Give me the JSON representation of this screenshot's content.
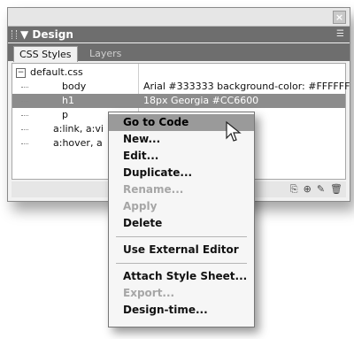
{
  "panel": {
    "close_icon": "close-icon",
    "title": "Design",
    "title_arrow": "▼",
    "options_icon": "panel-options-icon",
    "tabs": [
      {
        "label": "CSS Styles",
        "active": true
      },
      {
        "label": "Layers",
        "active": false
      }
    ]
  },
  "styles": {
    "file": {
      "expander": "−",
      "name": "default.css"
    },
    "rules": [
      {
        "name": "body",
        "value": "Arial #333333 background-color: #FFFFFF"
      },
      {
        "name": "h1",
        "value": "18px Georgia #CC6600",
        "selected": true
      },
      {
        "name": "p",
        "value": ""
      },
      {
        "name": "a:link, a:vi",
        "value": ""
      },
      {
        "name": "a:hover, a",
        "value": ""
      }
    ]
  },
  "toolbar": {
    "icons": [
      "attach-style-sheet-icon",
      "new-css-rule-icon",
      "edit-style-icon",
      "delete-icon"
    ]
  },
  "context_menu": {
    "items": [
      {
        "label": "Go to Code",
        "enabled": true,
        "highlighted": true
      },
      {
        "label": "New...",
        "enabled": true
      },
      {
        "label": "Edit...",
        "enabled": true
      },
      {
        "label": "Duplicate...",
        "enabled": true
      },
      {
        "label": "Rename...",
        "enabled": false
      },
      {
        "label": "Apply",
        "enabled": false
      },
      {
        "label": "Delete",
        "enabled": true
      },
      {
        "label": "Use External Editor",
        "enabled": true
      },
      {
        "label": "Attach Style Sheet...",
        "enabled": true
      },
      {
        "label": "Export...",
        "enabled": false
      },
      {
        "label": "Design-time...",
        "enabled": true
      }
    ]
  }
}
